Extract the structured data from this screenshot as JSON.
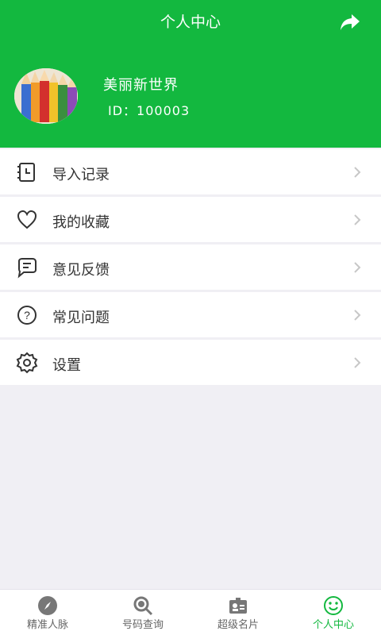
{
  "header": {
    "title": "个人中心",
    "share_icon": "share-icon"
  },
  "profile": {
    "name": "美丽新世界",
    "id": "ID：100003"
  },
  "menu": [
    {
      "label": "导入记录",
      "icon": "calendar-notebook-icon"
    },
    {
      "label": "我的收藏",
      "icon": "heart-icon"
    },
    {
      "label": "意见反馈",
      "icon": "comment-icon"
    },
    {
      "label": "常见问题",
      "icon": "question-icon"
    },
    {
      "label": "设置",
      "icon": "gear-icon"
    }
  ],
  "bottom_nav": [
    {
      "label": "精准人脉",
      "icon": "compass-icon"
    },
    {
      "label": "号码查询",
      "icon": "search-icon"
    },
    {
      "label": "超级名片",
      "icon": "contact-card-icon"
    },
    {
      "label": "个人中心",
      "icon": "smile-icon",
      "active": true
    }
  ],
  "colors": {
    "brand_green": "#13b83f",
    "background": "#f0eff4"
  }
}
